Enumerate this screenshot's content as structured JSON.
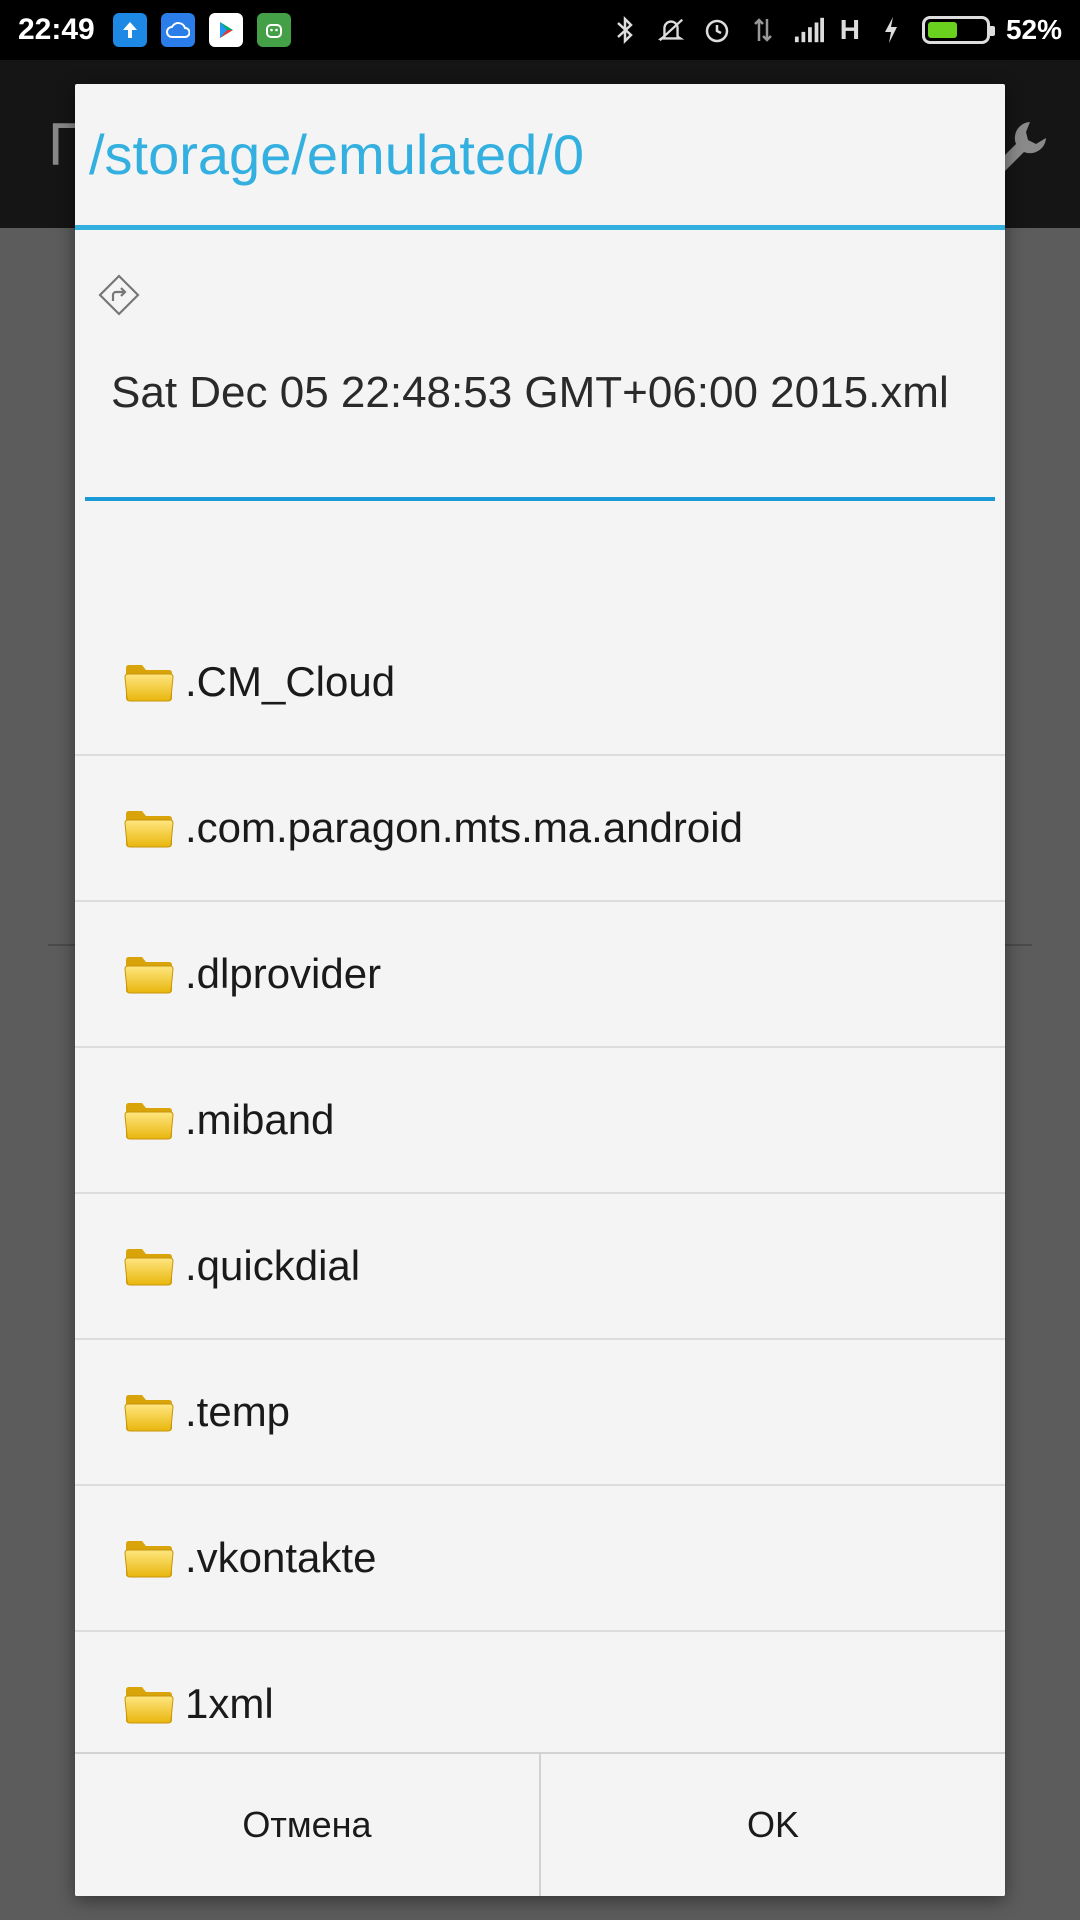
{
  "status_bar": {
    "time": "22:49",
    "battery_percent": "52%",
    "battery_level": 0.52,
    "network_type": "H",
    "notification_icons": [
      "upload-icon",
      "cloud-icon",
      "play-store-icon",
      "android-icon"
    ]
  },
  "dialog": {
    "title": "/storage/emulated/0",
    "filename_value": "Sat Dec 05 22:48:53 GMT+06:00 2015.xml",
    "folders": [
      ".CM_Cloud",
      ".com.paragon.mts.ma.android",
      ".dlprovider",
      ".miband",
      ".quickdial",
      ".temp",
      ".vkontakte",
      "1xml"
    ],
    "cancel_label": "Отмена",
    "ok_label": "OK"
  },
  "colors": {
    "accent": "#33b0e0",
    "input_underline": "#1a9ad6"
  }
}
